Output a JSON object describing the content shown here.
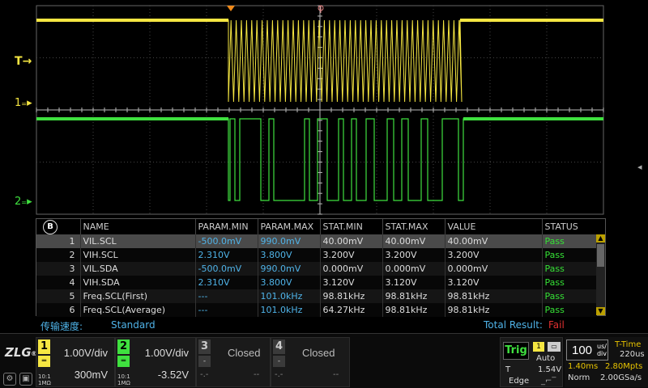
{
  "colors": {
    "ch1": "#f5e642",
    "ch2": "#3fe03f",
    "cyan": "#4fb3e8",
    "fail": "#e03030"
  },
  "markers": {
    "trigger_level": "T",
    "ch1_ref": "1",
    "ch2_ref": "2"
  },
  "table": {
    "badge": "B",
    "columns": [
      "",
      "NAME",
      "PARAM.MIN",
      "PARAM.MAX",
      "STAT.MIN",
      "STAT.MAX",
      "VALUE",
      "STATUS"
    ],
    "rows": [
      {
        "idx": "1",
        "name": "VIL.SCL",
        "pmin": "-500.0mV",
        "pmax": "990.0mV",
        "smin": "40.00mV",
        "smax": "40.00mV",
        "value": "40.00mV",
        "status": "Pass"
      },
      {
        "idx": "2",
        "name": "VIH.SCL",
        "pmin": "2.310V",
        "pmax": "3.800V",
        "smin": "3.200V",
        "smax": "3.200V",
        "value": "3.200V",
        "status": "Pass"
      },
      {
        "idx": "3",
        "name": "VIL.SDA",
        "pmin": "-500.0mV",
        "pmax": "990.0mV",
        "smin": "0.000mV",
        "smax": "0.000mV",
        "value": "0.000mV",
        "status": "Pass"
      },
      {
        "idx": "4",
        "name": "VIH.SDA",
        "pmin": "2.310V",
        "pmax": "3.800V",
        "smin": "3.120V",
        "smax": "3.120V",
        "value": "3.120V",
        "status": "Pass"
      },
      {
        "idx": "5",
        "name": "Freq.SCL(First)",
        "pmin": "---",
        "pmax": "101.0kHz",
        "smin": "98.81kHz",
        "smax": "98.81kHz",
        "value": "98.81kHz",
        "status": "Pass"
      },
      {
        "idx": "6",
        "name": "Freq.SCL(Average)",
        "pmin": "---",
        "pmax": "101.0kHz",
        "smin": "64.27kHz",
        "smax": "98.81kHz",
        "value": "98.81kHz",
        "status": "Pass"
      }
    ]
  },
  "status": {
    "speed_label": "传输速度:",
    "speed_value": "Standard",
    "result_label": "Total Result:",
    "result_value": "Fail"
  },
  "channels": {
    "ch1": {
      "num": "1",
      "scale": "1.00V/div",
      "offset": "300mV",
      "imp": "10:1 1MΩ"
    },
    "ch2": {
      "num": "2",
      "scale": "1.00V/div",
      "offset": "-3.52V",
      "imp": "10:1 1MΩ"
    },
    "ch3": {
      "num": "3",
      "state": "Closed",
      "d1": "-.-",
      "d2": "--"
    },
    "ch4": {
      "num": "4",
      "state": "Closed",
      "d1": "-.-",
      "d2": "--"
    }
  },
  "trigger": {
    "label": "Trig",
    "source": "1",
    "mode": "Auto",
    "t": "T",
    "level": "1.54V",
    "type": "Edge"
  },
  "timebase": {
    "value": "100",
    "unit_top": "us/",
    "unit_bottom": "div",
    "ttime_label": "T-Time",
    "ttime_value": "220us",
    "delay": "1.40ms",
    "memory": "2.80Mpts",
    "acq_mode": "Norm",
    "sample_rate": "2.00GSa/s"
  },
  "logo": {
    "text": "ZLG",
    "reg": "®"
  }
}
